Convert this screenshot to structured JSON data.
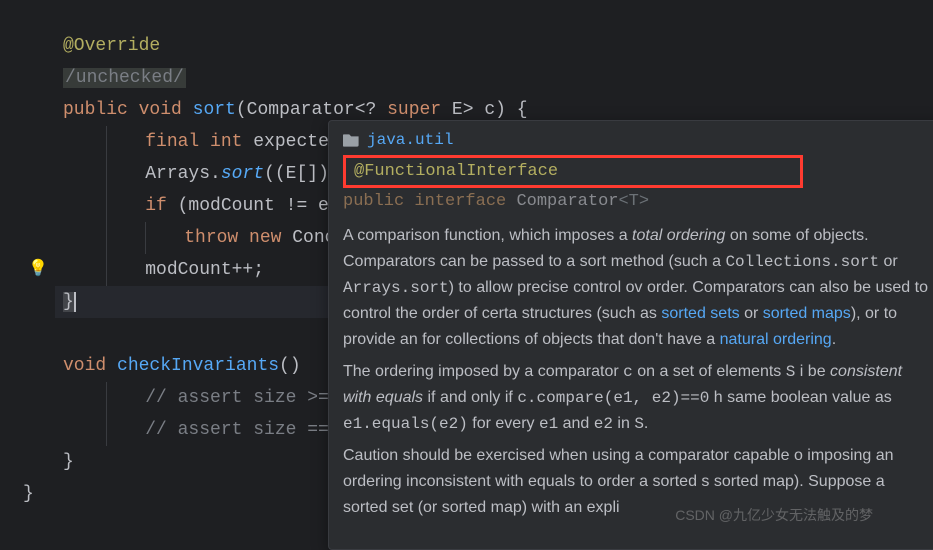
{
  "code": {
    "line1": "@Override",
    "line2": "/unchecked/",
    "line3_kw1": "public",
    "line3_kw2": "void",
    "line3_method": "sort",
    "line3_sig": "(Comparator<? ",
    "line3_kw3": "super",
    "line3_sig2": " E> c) {",
    "line4_kw1": "final",
    "line4_kw2": "int",
    "line4_var": " expected",
    "line5_obj": "Arrays.",
    "line5_call": "sort",
    "line5_args": "((E[]) ",
    "line6_kw": "if",
    "line6_cond": " (modCount != ex",
    "line7_kw1": "throw",
    "line7_kw2": "new",
    "line7_cls": " Conc",
    "line8": "modCount++;",
    "line9": "}",
    "line10_kw": "void",
    "line10_method": " checkInvariants",
    "line10_paren": "()",
    "line11": "// assert size >= ",
    "line12": "// assert size == ",
    "line13": "}",
    "line14": "}"
  },
  "tooltip": {
    "package": "java.util",
    "annotation": "@FunctionalInterface",
    "decl_kw1": "public",
    "decl_kw2": "interface",
    "decl_name": "Comparator",
    "decl_gen": "<T>",
    "desc1_a": "A comparison function, which imposes a ",
    "desc1_em": "total ordering",
    "desc1_b": " on some ",
    "desc2": "of objects. Comparators can be passed to a sort method (such a",
    "link1": "Collections.sort",
    "desc3_or": " or ",
    "link2": "Arrays.sort",
    "desc3_b": ") to allow precise control ov",
    "desc4": "order. Comparators can also be used to control the order of certa",
    "desc5_a": "structures (such as ",
    "link3": "sorted sets",
    "desc5_or": " or ",
    "link4": "sorted maps",
    "desc5_b": "), or to provide an ",
    "desc6_a": "for collections of objects that don't have a ",
    "link5": "natural ordering",
    "desc6_b": ".",
    "desc7_a": "The ordering imposed by a comparator ",
    "desc7_c": "c",
    "desc7_b": " on a set of elements ",
    "desc7_s": "S",
    "desc7_d": " i",
    "desc8_a": "be ",
    "desc8_em": "consistent with equals",
    "desc8_b": " if and only if ",
    "desc8_code": "c.compare(e1, e2)==0",
    "desc8_c": " h",
    "desc9_a": "same boolean value as ",
    "desc9_code": "e1.equals(e2)",
    "desc9_b": " for every ",
    "desc9_e1": "e1",
    "desc9_and": " and ",
    "desc9_e2": "e2",
    "desc9_in": " in ",
    "desc9_s": "S",
    "desc9_dot": ".",
    "desc10": "Caution should be exercised when using a comparator capable o",
    "desc11": "imposing an ordering inconsistent with equals to order a sorted s",
    "desc12": "sorted map). Suppose a sorted set (or sorted map) with an expli"
  },
  "watermark": "CSDN @九亿少女无法触及的梦"
}
